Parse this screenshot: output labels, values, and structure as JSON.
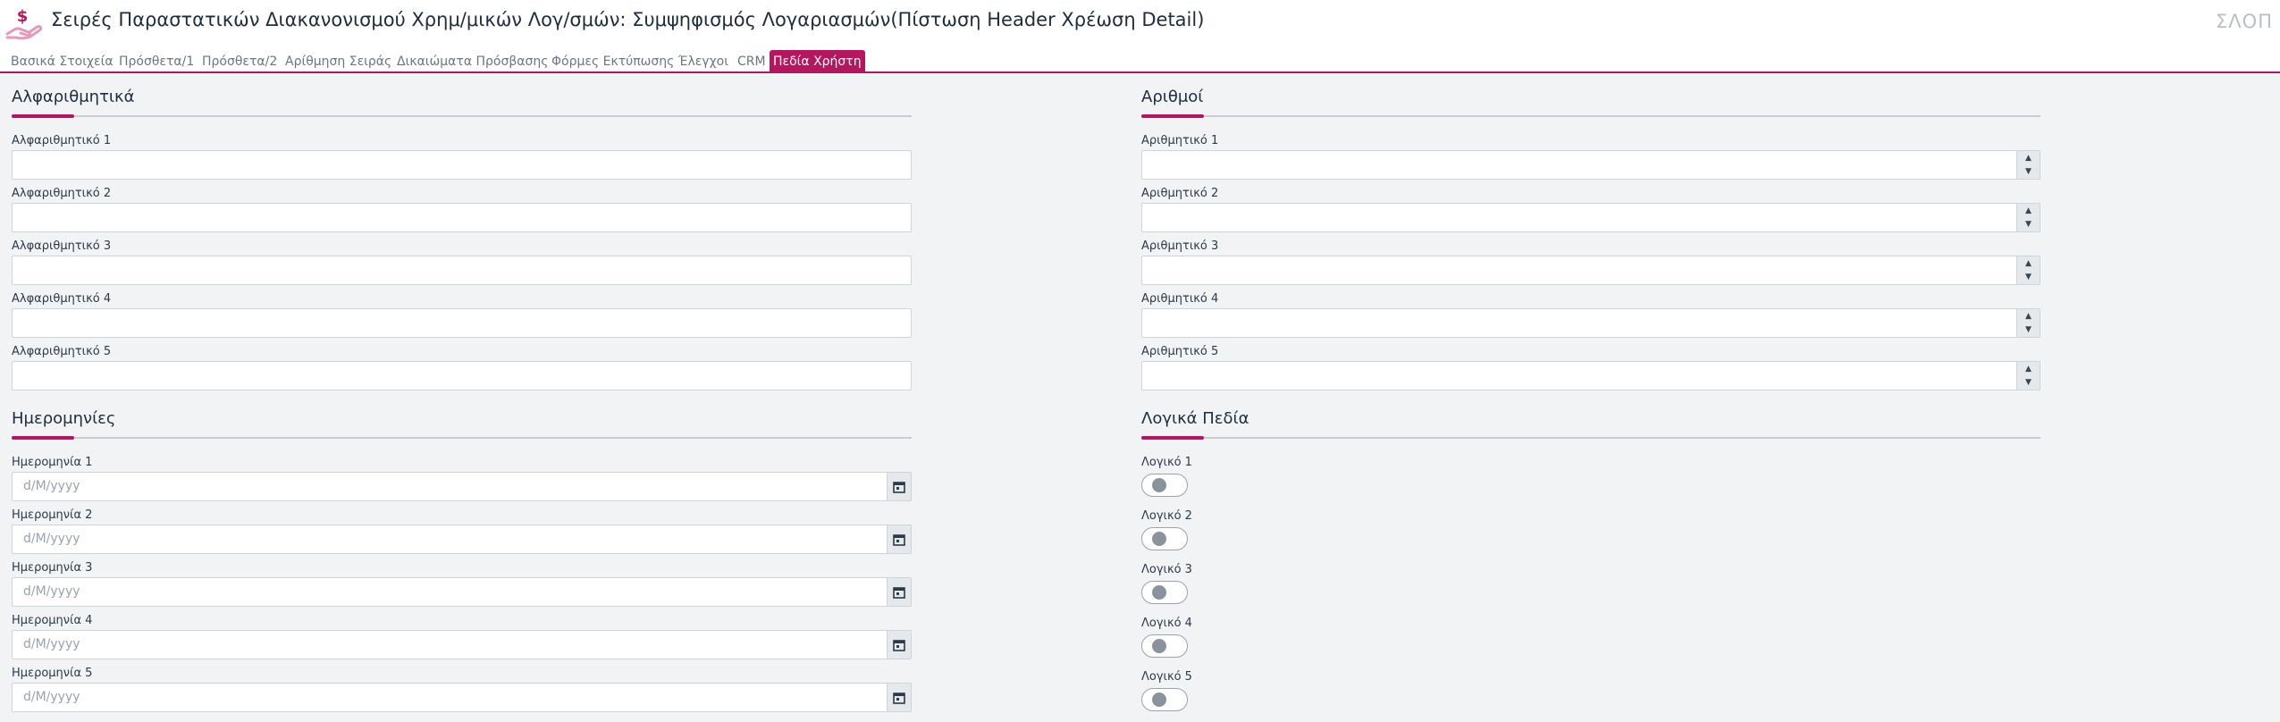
{
  "header": {
    "title": "Σειρές Παραστατικών Διακανονισμού Χρημ/μικών Λογ/σμών: Συμψηφισμός Λογαριασμών(Πίστωση Header Χρέωση Detail)",
    "user_code": "ΣΛΟΠ",
    "icon": "money-hand-icon"
  },
  "tabs": [
    {
      "label": "Βασικά Στοιχεία"
    },
    {
      "label": "Πρόσθετα/1"
    },
    {
      "label": "Πρόσθετα/2"
    },
    {
      "label": "Αρίθμηση Σειράς"
    },
    {
      "label": "Δικαιώματα Πρόσβασης"
    },
    {
      "label": "Φόρμες Εκτύπωσης"
    },
    {
      "label": "Έλεγχοι"
    },
    {
      "label": "CRM"
    },
    {
      "label": "Πεδία Χρήστη",
      "active": true
    }
  ],
  "sections": {
    "alphanumeric": {
      "title": "Αλφαριθμητικά",
      "fields": [
        {
          "label": "Αλφαριθμητικό 1",
          "value": ""
        },
        {
          "label": "Αλφαριθμητικό 2",
          "value": ""
        },
        {
          "label": "Αλφαριθμητικό 3",
          "value": ""
        },
        {
          "label": "Αλφαριθμητικό 4",
          "value": ""
        },
        {
          "label": "Αλφαριθμητικό 5",
          "value": ""
        }
      ]
    },
    "numbers": {
      "title": "Αριθμοί",
      "fields": [
        {
          "label": "Αριθμητικό 1",
          "value": ""
        },
        {
          "label": "Αριθμητικό 2",
          "value": ""
        },
        {
          "label": "Αριθμητικό 3",
          "value": ""
        },
        {
          "label": "Αριθμητικό 4",
          "value": ""
        },
        {
          "label": "Αριθμητικό 5",
          "value": ""
        }
      ]
    },
    "dates": {
      "title": "Ημερομηνίες",
      "fields": [
        {
          "label": "Ημερομηνία 1",
          "placeholder": "d/M/yyyy"
        },
        {
          "label": "Ημερομηνία 2",
          "placeholder": "d/M/yyyy"
        },
        {
          "label": "Ημερομηνία 3",
          "placeholder": "d/M/yyyy"
        },
        {
          "label": "Ημερομηνία 4",
          "placeholder": "d/M/yyyy"
        },
        {
          "label": "Ημερομηνία 5",
          "placeholder": "d/M/yyyy"
        }
      ]
    },
    "booleans": {
      "title": "Λογικά Πεδία",
      "fields": [
        {
          "label": "Λογικό 1",
          "checked": false
        },
        {
          "label": "Λογικό 2",
          "checked": false
        },
        {
          "label": "Λογικό 3",
          "checked": false
        },
        {
          "label": "Λογικό 4",
          "checked": false
        },
        {
          "label": "Λογικό 5",
          "checked": false
        }
      ]
    }
  },
  "colors": {
    "accent": "#b5175e",
    "background": "#f1f3f5"
  }
}
